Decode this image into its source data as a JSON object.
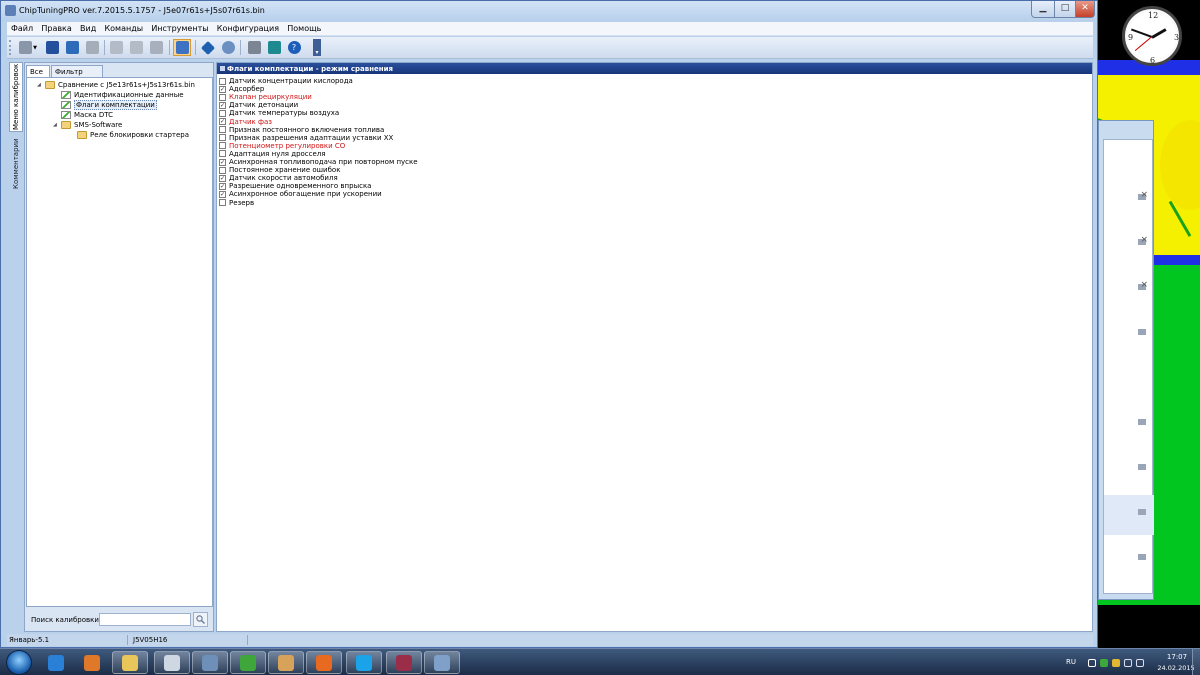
{
  "window": {
    "title": "ChipTuningPRO ver.7.2015.5.1757 - J5e07r61s+J5s07r61s.bin",
    "min_icon": "minimize-icon",
    "max_icon": "maximize-icon",
    "close_icon": "close-icon"
  },
  "menu": [
    "Файл",
    "Правка",
    "Вид",
    "Команды",
    "Инструменты",
    "Конфигурация",
    "Помощь"
  ],
  "vertical_tabs": [
    "Меню калибровок",
    "Комментарии"
  ],
  "left_panel": {
    "tabs": [
      "Все",
      "Фильтр"
    ],
    "tree": [
      {
        "label": "Сравнение с J5e13r61s+J5s13r61s.bin",
        "level": 0,
        "icon": "folder-icon",
        "expanded": true
      },
      {
        "label": "Идентификационные данные",
        "level": 1,
        "icon": "checklist-icon"
      },
      {
        "label": "Флаги комплектации",
        "level": 1,
        "icon": "checklist-icon",
        "selected": true
      },
      {
        "label": "Маска DTC",
        "level": 1,
        "icon": "checklist-icon"
      },
      {
        "label": "SMS-Software",
        "level": 1,
        "icon": "folder-icon",
        "expanded": true
      },
      {
        "label": "Реле блокировки стартера",
        "level": 2,
        "icon": "folder-icon"
      }
    ],
    "search_label": "Поиск калибровки",
    "search_value": ""
  },
  "right_panel": {
    "header": "Флаги комплектации - режим сравнения",
    "flags": [
      {
        "label": "Датчик концентрации кислорода",
        "checked": false,
        "diff": false
      },
      {
        "label": "Адсорбер",
        "checked": true,
        "diff": false
      },
      {
        "label": "Клапан рециркуляции",
        "checked": false,
        "diff": true
      },
      {
        "label": "Датчик детонации",
        "checked": true,
        "diff": false
      },
      {
        "label": "Датчик температуры воздуха",
        "checked": false,
        "diff": false
      },
      {
        "label": "Датчик фаз",
        "checked": true,
        "diff": true
      },
      {
        "label": "Признак постоянного включения топлива",
        "checked": false,
        "diff": false
      },
      {
        "label": "Признак разрешения адаптации уставки ХХ",
        "checked": false,
        "diff": false
      },
      {
        "label": "Потенциометр регулировки СО",
        "checked": false,
        "diff": true
      },
      {
        "label": "Адаптация нуля дросселя",
        "checked": false,
        "diff": false
      },
      {
        "label": "Асинхронная топливоподача при повторном пуске",
        "checked": true,
        "diff": false
      },
      {
        "label": "Постоянное хранение ошибок",
        "checked": false,
        "diff": false
      },
      {
        "label": "Датчик скорости автомобиля",
        "checked": true,
        "diff": false
      },
      {
        "label": "Разрешение одновременного впрыска",
        "checked": true,
        "diff": false
      },
      {
        "label": "Асинхронное обогащение при ускорении",
        "checked": true,
        "diff": false
      },
      {
        "label": "Резерв",
        "checked": false,
        "diff": false
      }
    ],
    "diff_color": "#d01515"
  },
  "status": {
    "left": "Январь-5.1",
    "mid": "J5V05H16"
  },
  "taskbar": {
    "apps": [
      {
        "name": "ie",
        "color": "#2a7fd6"
      },
      {
        "name": "media-player",
        "color": "#e0782a"
      },
      {
        "name": "explorer",
        "color": "#e9c65a"
      },
      {
        "name": "calendar",
        "color": "#cfd7e2"
      },
      {
        "name": "chiptuning",
        "color": "#6d8fb8"
      },
      {
        "name": "utorrent",
        "color": "#3ea63a"
      },
      {
        "name": "paint",
        "color": "#d7a35a"
      },
      {
        "name": "firefox",
        "color": "#e76a20"
      },
      {
        "name": "skype",
        "color": "#1aa3e8"
      },
      {
        "name": "winrar",
        "color": "#9a2d48"
      },
      {
        "name": "ctp-window",
        "color": "#7fa1c9"
      }
    ],
    "lang": "RU",
    "time": "17:07",
    "date": "24.02.2015"
  }
}
